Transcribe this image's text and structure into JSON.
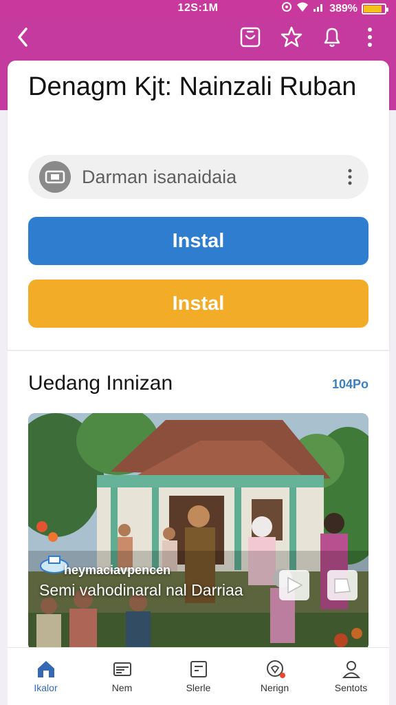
{
  "status": {
    "time": "12S:1M",
    "battery": "389%",
    "battery_level": 0.85
  },
  "colors": {
    "brand": "#c43a9e",
    "primary_button": "#2f7dce",
    "secondary_button": "#f2ac28",
    "link": "#3d7fbd"
  },
  "app_bar": {
    "icons": [
      "back-arrow-icon",
      "bag-icon",
      "star-icon",
      "bell-icon",
      "more-vert-icon"
    ]
  },
  "app": {
    "title": "Denagm Kjt: Nainzali Ruban",
    "developer": "Darman isanaidaia",
    "install_primary": "Instal",
    "install_secondary": "Instal"
  },
  "section": {
    "title": "Uedang Innizan",
    "link": "104Po",
    "hero": {
      "sub": "heymaciavpencen",
      "caption": "Semi vahodinaral nal Darriaa"
    }
  },
  "bottom_nav": {
    "items": [
      {
        "label": "Ikalor",
        "icon": "home-icon",
        "active": true
      },
      {
        "label": "Nem",
        "icon": "card-icon",
        "active": false
      },
      {
        "label": "Slerle",
        "icon": "grid-icon",
        "active": false
      },
      {
        "label": "Nerign",
        "icon": "heart-chat-icon",
        "active": false
      },
      {
        "label": "Sentots",
        "icon": "person-icon",
        "active": false
      }
    ]
  }
}
